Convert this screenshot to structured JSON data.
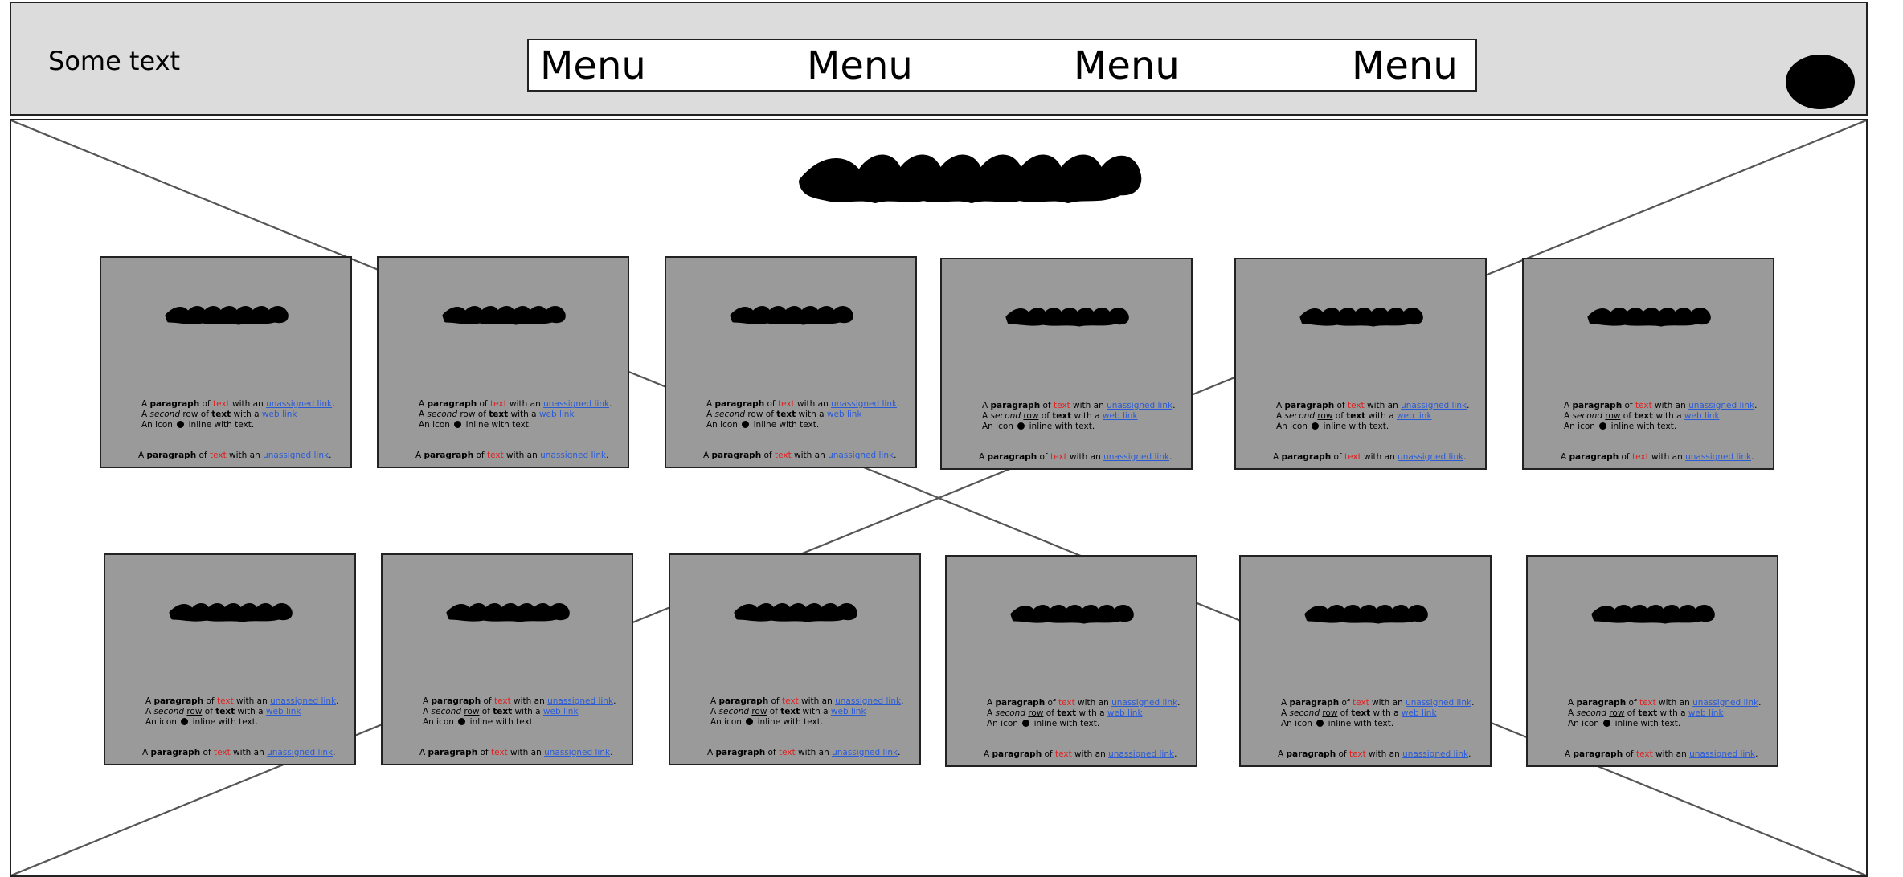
{
  "header": {
    "brand_text": "Some text",
    "menu": [
      {
        "label": "Menu"
      },
      {
        "label": "Menu"
      },
      {
        "label": "Menu"
      },
      {
        "label": "Menu"
      }
    ]
  },
  "card": {
    "line1": {
      "pre": "A ",
      "bold": "paragraph",
      "of": " of ",
      "red": "text",
      "mid": " with an ",
      "link": "unassigned link",
      "end": "."
    },
    "line2": {
      "pre": "A ",
      "italic": "second",
      "space1": " ",
      "underline": "row",
      "of": " of ",
      "text": "text",
      "mid": " with a ",
      "link": "web link"
    },
    "line3": {
      "pre": "An icon ",
      "post": " inline with text."
    },
    "footer": {
      "pre": "A ",
      "bold": "paragraph",
      "of": " of ",
      "red": "text",
      "mid": " with an ",
      "link": "unassigned link",
      "end": "."
    }
  },
  "cards_count": 12,
  "colors": {
    "header_bg": "#dcdcdc",
    "card_bg": "#9a9a9a",
    "link": "#2a5bd7",
    "red_text": "#e02020"
  },
  "icons": {
    "hero_scribble": "scribble-title-icon",
    "card_scribble": "scribble-title-icon",
    "inline_icon": "circle-icon",
    "avatar": "avatar-circle"
  }
}
